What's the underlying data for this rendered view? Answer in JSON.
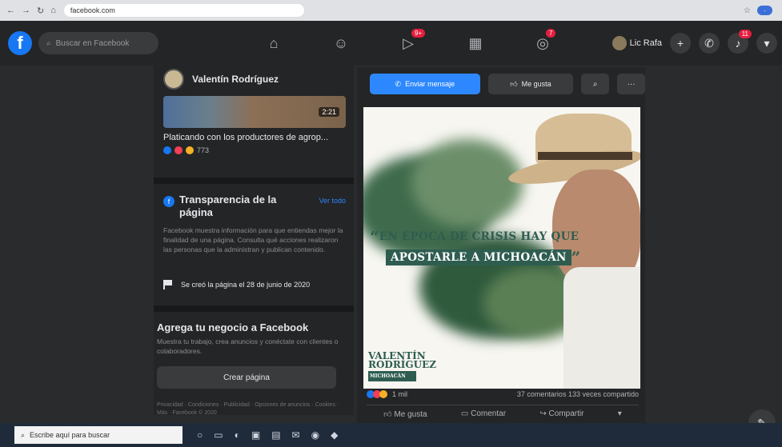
{
  "browser": {
    "url": "facebook.com"
  },
  "header": {
    "logo": "f",
    "search_placeholder": "Buscar en Facebook",
    "nav_badges": {
      "watch": "9+",
      "groups": "7"
    },
    "profile_name": "Lic Rafa",
    "notifications_badge": "11"
  },
  "left": {
    "page_name": "Valentín Rodríguez",
    "video": {
      "duration": "2:21",
      "title": "Platicando con los productores de agrop...",
      "reactions": "773"
    },
    "transparency": {
      "title": "Transparencia de la página",
      "see_all": "Ver todo",
      "description": "Facebook muestra información para que entiendas mejor la finalidad de una página. Consulta qué acciones realizaron las personas que la administran y publican contenido.",
      "created": "Se creó la página el 28 de junio de 2020"
    },
    "add_business": {
      "title": "Agrega tu negocio a Facebook",
      "description": "Muestra tu trabajo, crea anuncios y conéctate con clientes o colaboradores.",
      "button": "Crear página"
    },
    "footer": "Privacidad · Condiciones · Publicidad · Opciones de anuncios · Cookies · Más · Facebook © 2020"
  },
  "actions": {
    "message": "Enviar mensaje",
    "like": "Me gusta",
    "search_icon": "search-icon",
    "more": "···"
  },
  "post": {
    "quote_line1": "EN ÉPOCA DE CRISIS HAY QUE",
    "quote_line2": "APOSTARLE A MICHOACÁN",
    "open_quote": "“",
    "close_quote": "”",
    "watermark_line1": "VALENTÍN",
    "watermark_line2": "RODRÍGUEZ",
    "watermark_sub": "MICHOACÁN",
    "reactions_count": "1 mil",
    "comments_shares": "37 comentarios  133 veces compartido",
    "btn_like": "Me gusta",
    "btn_comment": "Comentar",
    "btn_share": "Compartir"
  },
  "taskbar": {
    "search_placeholder": "Escribe aquí para buscar"
  },
  "colors": {
    "fb_blue": "#1877f2",
    "bg_dark": "#242526",
    "accent_green": "#2e5d50"
  }
}
